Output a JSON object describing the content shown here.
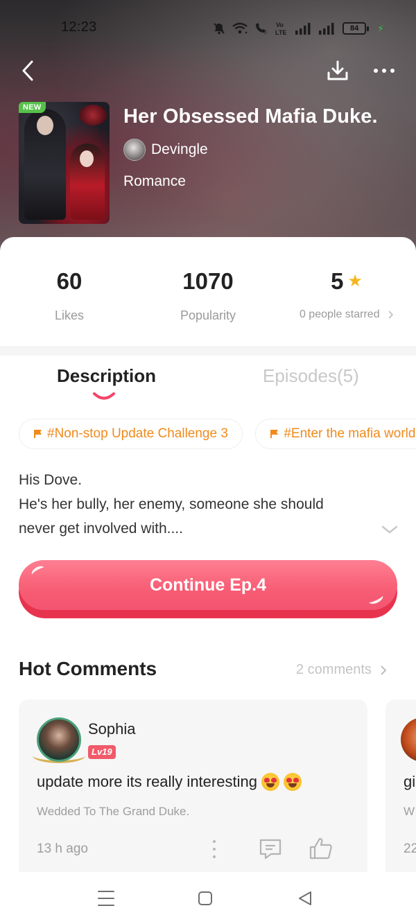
{
  "status_bar": {
    "time": "12:23",
    "network_label": "Vo LTE",
    "battery_level": "84",
    "icons": [
      "mute-icon",
      "wifi-icon",
      "wifi-call-icon",
      "volte-icon",
      "signal-icon",
      "signal-icon",
      "battery-icon",
      "charging-icon"
    ]
  },
  "top_nav": {
    "icons": [
      "back-icon",
      "download-icon",
      "more-icon"
    ]
  },
  "book": {
    "badge": "NEW",
    "title": "Her Obsessed Mafia Duke.",
    "author": "Devingle",
    "genre": "Romance"
  },
  "stats": [
    {
      "value": "60",
      "label": "Likes"
    },
    {
      "value": "1070",
      "label": "Popularity"
    },
    {
      "value": "5",
      "label": "0 people starred"
    }
  ],
  "tabs": {
    "description": "Description",
    "episodes": "Episodes(5)"
  },
  "tags": [
    "#Non-stop Update Challenge 3",
    "#Enter the mafia world"
  ],
  "description": {
    "line1": "His Dove.",
    "line2": "He's her bully, her enemy, someone she should",
    "line3": "never get involved with...."
  },
  "cta": {
    "label": "Continue Ep.4"
  },
  "comments": {
    "title": "Hot Comments",
    "count_label": "2 comments",
    "items": [
      {
        "user": "Sophia",
        "level": "Lv19",
        "text": "update more its really interesting",
        "source": "Wedded To The Grand Duke.",
        "time": "13 h ago"
      },
      {
        "text": "gi",
        "source": "W",
        "time": "22"
      }
    ]
  },
  "colors": {
    "accent": "#f75d74",
    "tag": "#f08a1c",
    "star": "#f6b51b",
    "new_badge": "#56c14a",
    "level_badge": "#f15a6a"
  }
}
